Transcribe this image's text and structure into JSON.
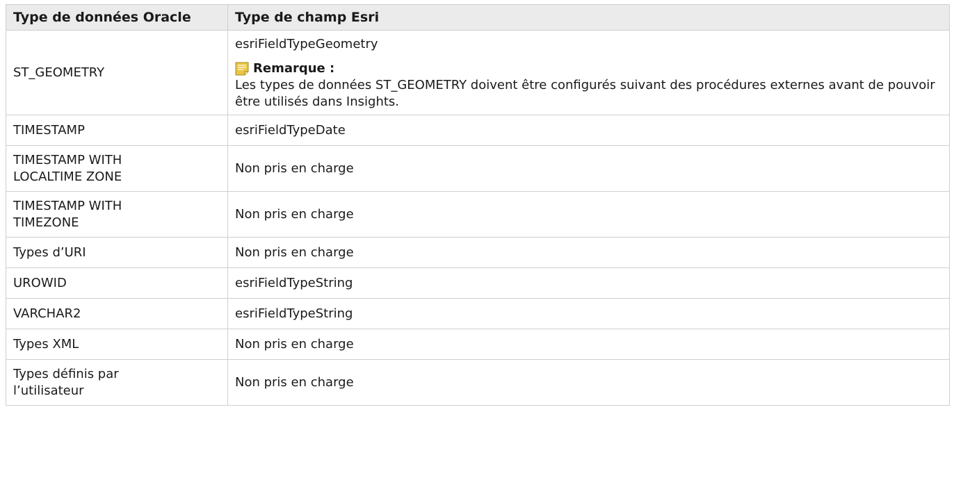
{
  "table": {
    "headers": [
      "Type de données Oracle",
      "Type de champ Esri"
    ],
    "rows": [
      {
        "oracle": "ST_GEOMETRY",
        "esri": "esriFieldTypeGeometry",
        "note": {
          "icon": "note-icon",
          "title": "Remarque :",
          "text": "Les types de données ST_GEOMETRY doivent être configurés suivant des procédures externes avant de pouvoir être utilisés dans Insights."
        }
      },
      {
        "oracle": "TIMESTAMP",
        "esri": "esriFieldTypeDate"
      },
      {
        "oracle": "TIMESTAMP WITH LOCALTIME ZONE",
        "esri": "Non pris en charge"
      },
      {
        "oracle": "TIMESTAMP WITH TIMEZONE",
        "esri": "Non pris en charge"
      },
      {
        "oracle": "Types d’URI",
        "esri": "Non pris en charge"
      },
      {
        "oracle": "UROWID",
        "esri": "esriFieldTypeString"
      },
      {
        "oracle": "VARCHAR2",
        "esri": "esriFieldTypeString"
      },
      {
        "oracle": "Types XML",
        "esri": "Non pris en charge"
      },
      {
        "oracle": "Types définis par l’utilisateur",
        "esri": "Non pris en charge"
      }
    ]
  },
  "colors": {
    "header_bg": "#ebebeb",
    "border": "#cfcfcf",
    "note_icon": "#e9c645"
  }
}
